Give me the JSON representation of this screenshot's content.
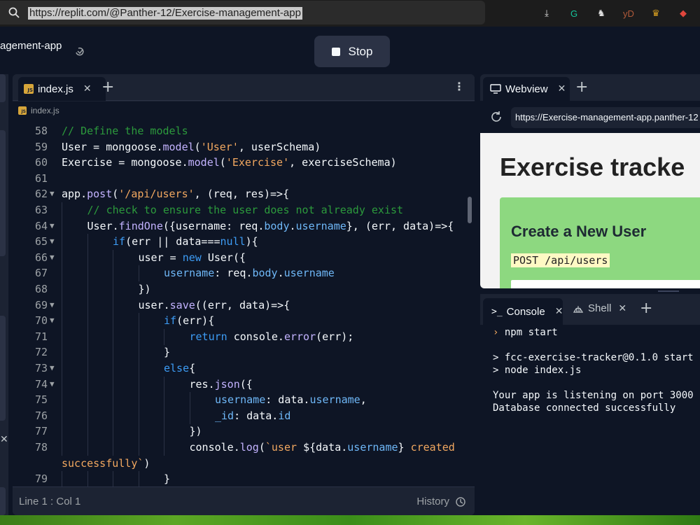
{
  "browser": {
    "url": "https://replit.com/@Panther-12/Exercise-management-app",
    "extensions": [
      {
        "name": "download-icon",
        "glyph": "⤓",
        "color": "#e0e0e0"
      },
      {
        "name": "grammarly-icon",
        "glyph": "G",
        "color": "#15c39a"
      },
      {
        "name": "extension-icon",
        "glyph": "♞",
        "color": "#e0e0e0"
      },
      {
        "name": "yd-icon",
        "glyph": "yD",
        "color": "#b05a3a"
      },
      {
        "name": "medal-icon",
        "glyph": "♛",
        "color": "#d9a020"
      },
      {
        "name": "eraser-icon",
        "glyph": "◆",
        "color": "#e0463c"
      }
    ]
  },
  "header": {
    "repl_name": "agement-app",
    "stop_label": "Stop"
  },
  "editor": {
    "tab_label": "index.js",
    "breadcrumb": "index.js",
    "status_left": "Line 1 : Col 1",
    "history_label": "History",
    "lines": [
      {
        "n": "58",
        "fold": "",
        "indent": 0,
        "html": "<span class=\"c-com\">// Define the models</span>"
      },
      {
        "n": "59",
        "fold": "",
        "indent": 0,
        "html": "User = mongoose.<span class=\"c-fn\">model</span>(<span class=\"c-str\">'User'</span>, userSchema)"
      },
      {
        "n": "60",
        "fold": "",
        "indent": 0,
        "html": "Exercise = mongoose.<span class=\"c-fn\">model</span>(<span class=\"c-str\">'Exercise'</span>, exerciseSchema)"
      },
      {
        "n": "61",
        "fold": "",
        "indent": 0,
        "html": ""
      },
      {
        "n": "62",
        "fold": "▼",
        "indent": 0,
        "html": "app.<span class=\"c-fn\">post</span>(<span class=\"c-str\">'/api/users'</span>, (req, res)=>{"
      },
      {
        "n": "63",
        "fold": "",
        "indent": 1,
        "html": "<span class=\"c-com\">// check to ensure the user does not already exist</span>"
      },
      {
        "n": "64",
        "fold": "▼",
        "indent": 1,
        "html": "User.<span class=\"c-fn\">findOne</span>({username: req.<span class=\"c-prop\">body</span>.<span class=\"c-prop\">username</span>}, (err, data)=>{"
      },
      {
        "n": "65",
        "fold": "▼",
        "indent": 2,
        "html": "<span class=\"c-kw\">if</span>(err || data===<span class=\"c-kw\">null</span>){"
      },
      {
        "n": "66",
        "fold": "▼",
        "indent": 3,
        "html": "user = <span class=\"c-kw\">new</span> User({"
      },
      {
        "n": "67",
        "fold": "",
        "indent": 4,
        "html": "<span class=\"c-prop\">username</span>: req.<span class=\"c-prop\">body</span>.<span class=\"c-prop\">username</span>"
      },
      {
        "n": "68",
        "fold": "",
        "indent": 3,
        "html": "})"
      },
      {
        "n": "69",
        "fold": "▼",
        "indent": 3,
        "html": "user.<span class=\"c-fn\">save</span>((err, data)=>{"
      },
      {
        "n": "70",
        "fold": "▼",
        "indent": 4,
        "html": "<span class=\"c-kw\">if</span>(err){"
      },
      {
        "n": "71",
        "fold": "",
        "indent": 5,
        "html": "<span class=\"c-kw\">return</span> console.<span class=\"c-fn\">error</span>(err);"
      },
      {
        "n": "72",
        "fold": "",
        "indent": 4,
        "html": "}"
      },
      {
        "n": "73",
        "fold": "▼",
        "indent": 4,
        "html": "<span class=\"c-kw\">else</span>{"
      },
      {
        "n": "74",
        "fold": "▼",
        "indent": 5,
        "html": "res.<span class=\"c-fn\">json</span>({"
      },
      {
        "n": "75",
        "fold": "",
        "indent": 6,
        "html": "<span class=\"c-prop\">username</span>: data.<span class=\"c-prop\">username</span>,"
      },
      {
        "n": "76",
        "fold": "",
        "indent": 6,
        "html": "<span class=\"c-prop\">_id</span>: data.<span class=\"c-prop\">id</span>"
      },
      {
        "n": "77",
        "fold": "",
        "indent": 5,
        "html": "})"
      },
      {
        "n": "78",
        "fold": "",
        "indent": 5,
        "html": "console.<span class=\"c-fn\">log</span>(<span class=\"c-str\">`user </span>${data.<span class=\"c-prop\">username</span>}<span class=\"c-str\"> created</span>"
      },
      {
        "n": "",
        "fold": "",
        "indent": 0,
        "html": "<span class=\"c-str\">successfully`</span>)"
      },
      {
        "n": "79",
        "fold": "",
        "indent": 4,
        "html": "}"
      }
    ]
  },
  "webview": {
    "tab_label": "Webview",
    "url": "https://Exercise-management-app.panther-12",
    "page_title": "Exercise tracke",
    "card_title": "Create a New User",
    "card_code": "POST /api/users"
  },
  "console": {
    "tab_label": "Console",
    "shell_label": "Shell",
    "lines": [
      {
        "prompt": true,
        "text": "npm start"
      },
      {
        "prompt": false,
        "text": ""
      },
      {
        "prompt": false,
        "text": "> fcc-exercise-tracker@0.1.0 start"
      },
      {
        "prompt": false,
        "text": "> node index.js"
      },
      {
        "prompt": false,
        "text": ""
      },
      {
        "prompt": false,
        "text": "Your app is listening on port 3000"
      },
      {
        "prompt": false,
        "text": "Database connected successfully"
      }
    ]
  }
}
